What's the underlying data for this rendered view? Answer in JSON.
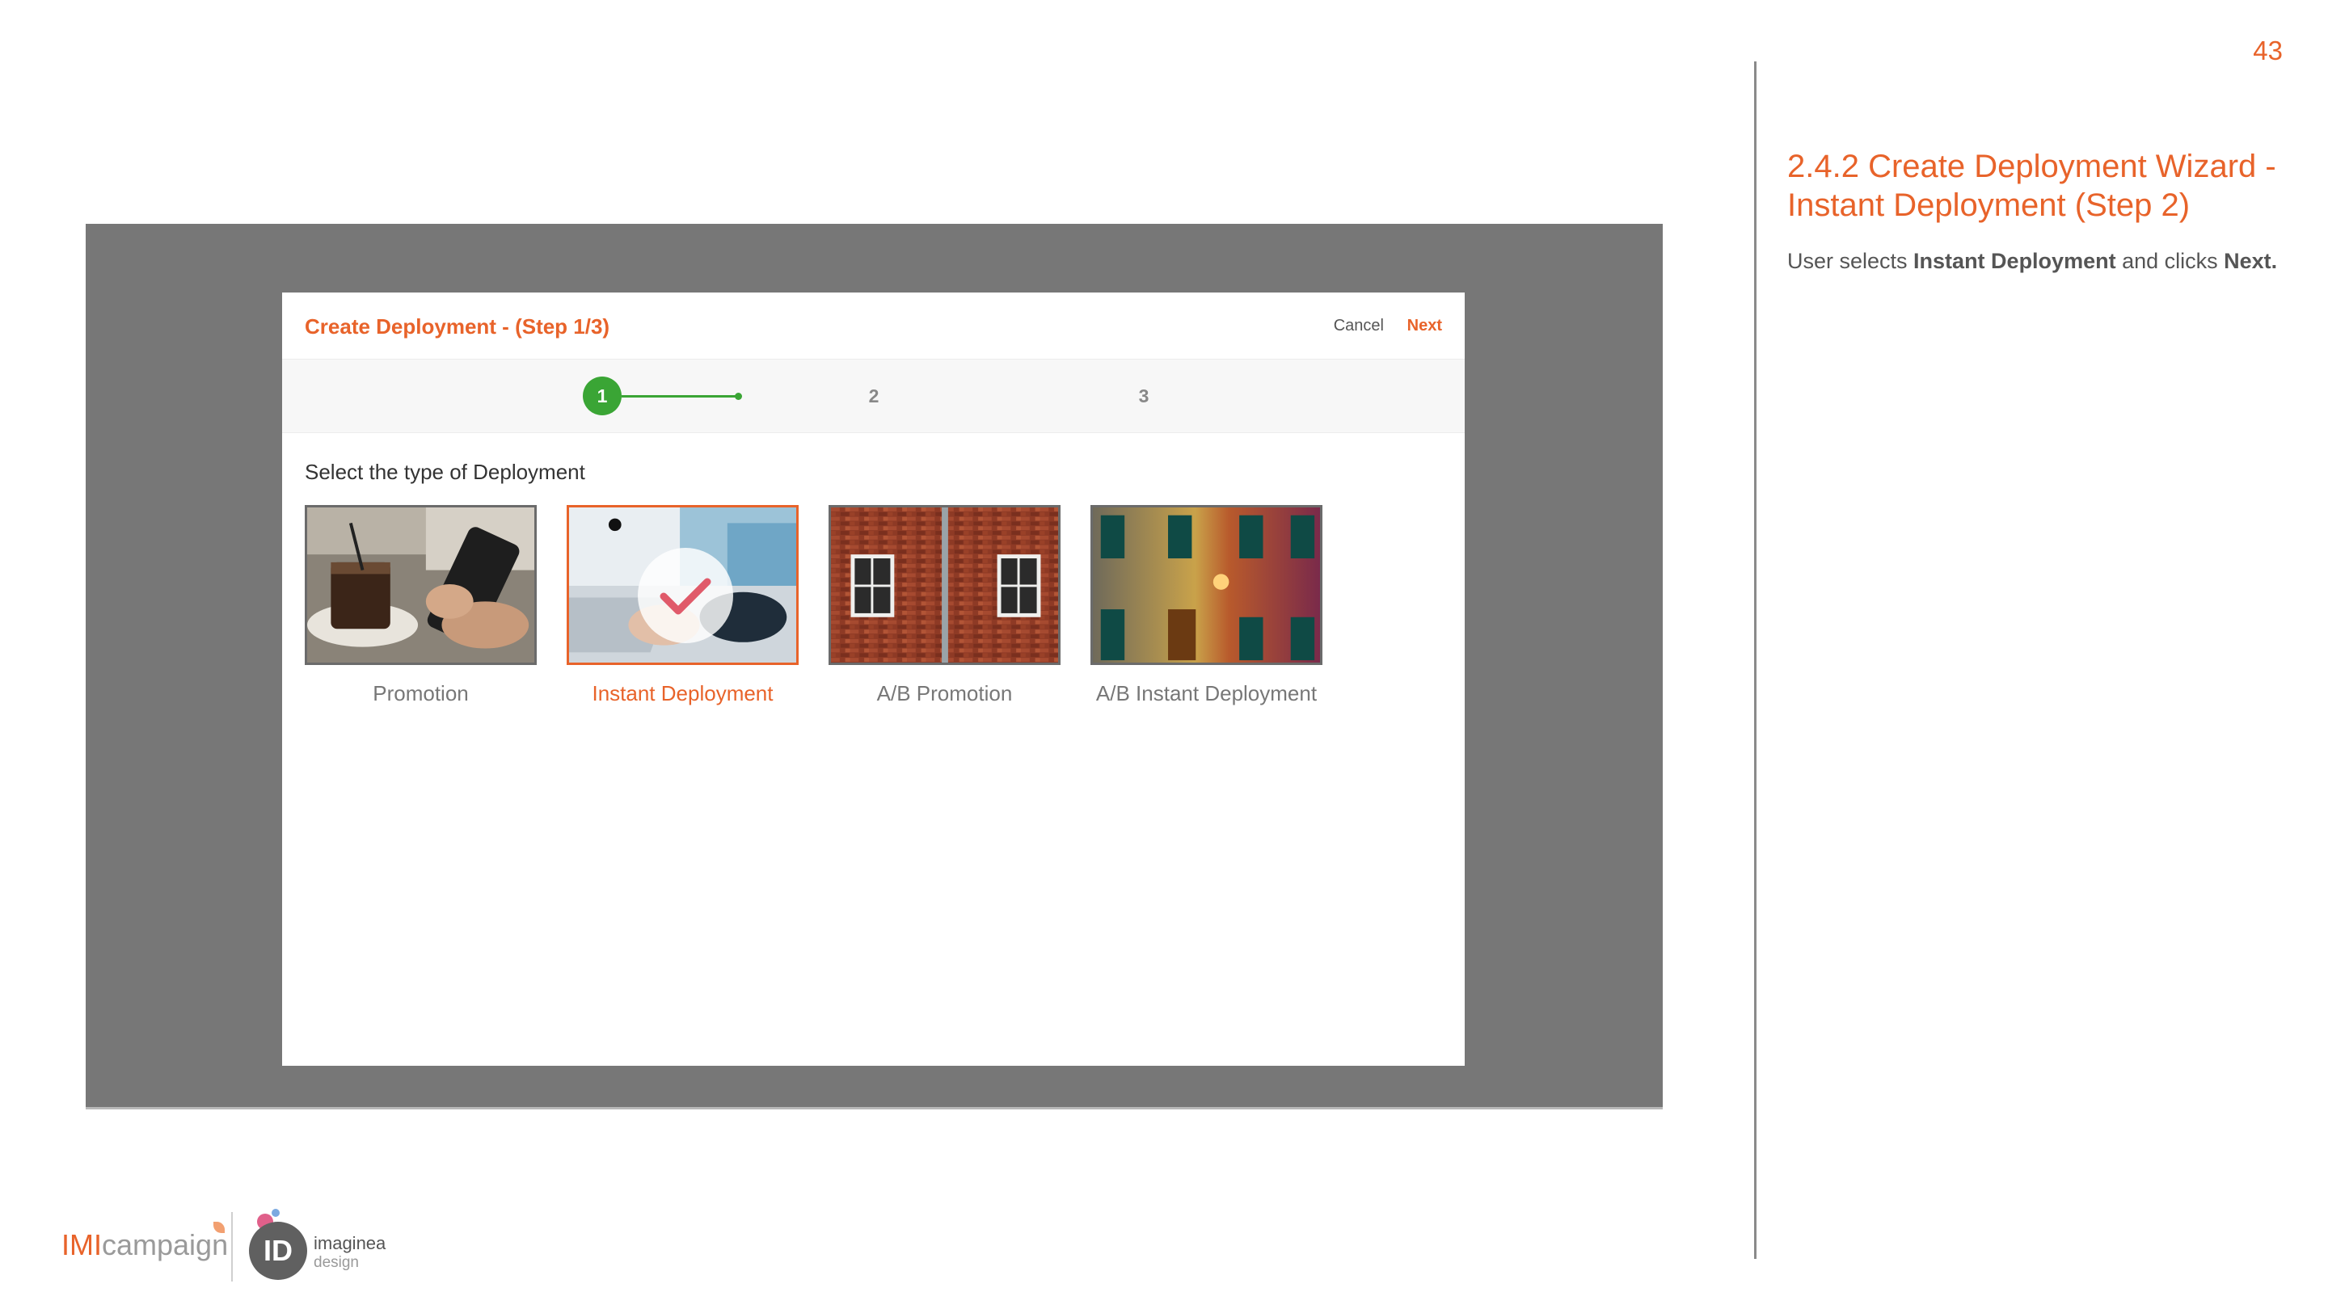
{
  "page_number": "43",
  "section": {
    "title": "2.4.2 Create Deployment Wizard - Instant Deployment (Step 2)",
    "desc_prefix": "User selects ",
    "desc_bold1": "Instant Deployment",
    "desc_middle": " and clicks ",
    "desc_bold2": "Next."
  },
  "modal": {
    "title": "Create Deployment - (Step 1/3)",
    "cancel_label": "Cancel",
    "next_label": "Next",
    "steps": [
      "1",
      "2",
      "3"
    ],
    "active_step": 1,
    "prompt": "Select the type of Deployment",
    "cards": [
      {
        "label": "Promotion",
        "selected": false,
        "image": "coffee-and-phone"
      },
      {
        "label": "Instant Deployment",
        "selected": true,
        "image": "laptop-keyboard"
      },
      {
        "label": "A/B Promotion",
        "selected": false,
        "image": "brick-wall-windows"
      },
      {
        "label": "A/B Instant Deployment",
        "selected": false,
        "image": "colored-facade"
      }
    ]
  },
  "footer": {
    "imi": "IMI",
    "campaign": "campaign",
    "id_logo": "ID",
    "imaginea": "imaginea",
    "design": "design"
  },
  "colors": {
    "accent": "#e8632a",
    "step_active": "#3aa535",
    "overlay": "#777777"
  }
}
